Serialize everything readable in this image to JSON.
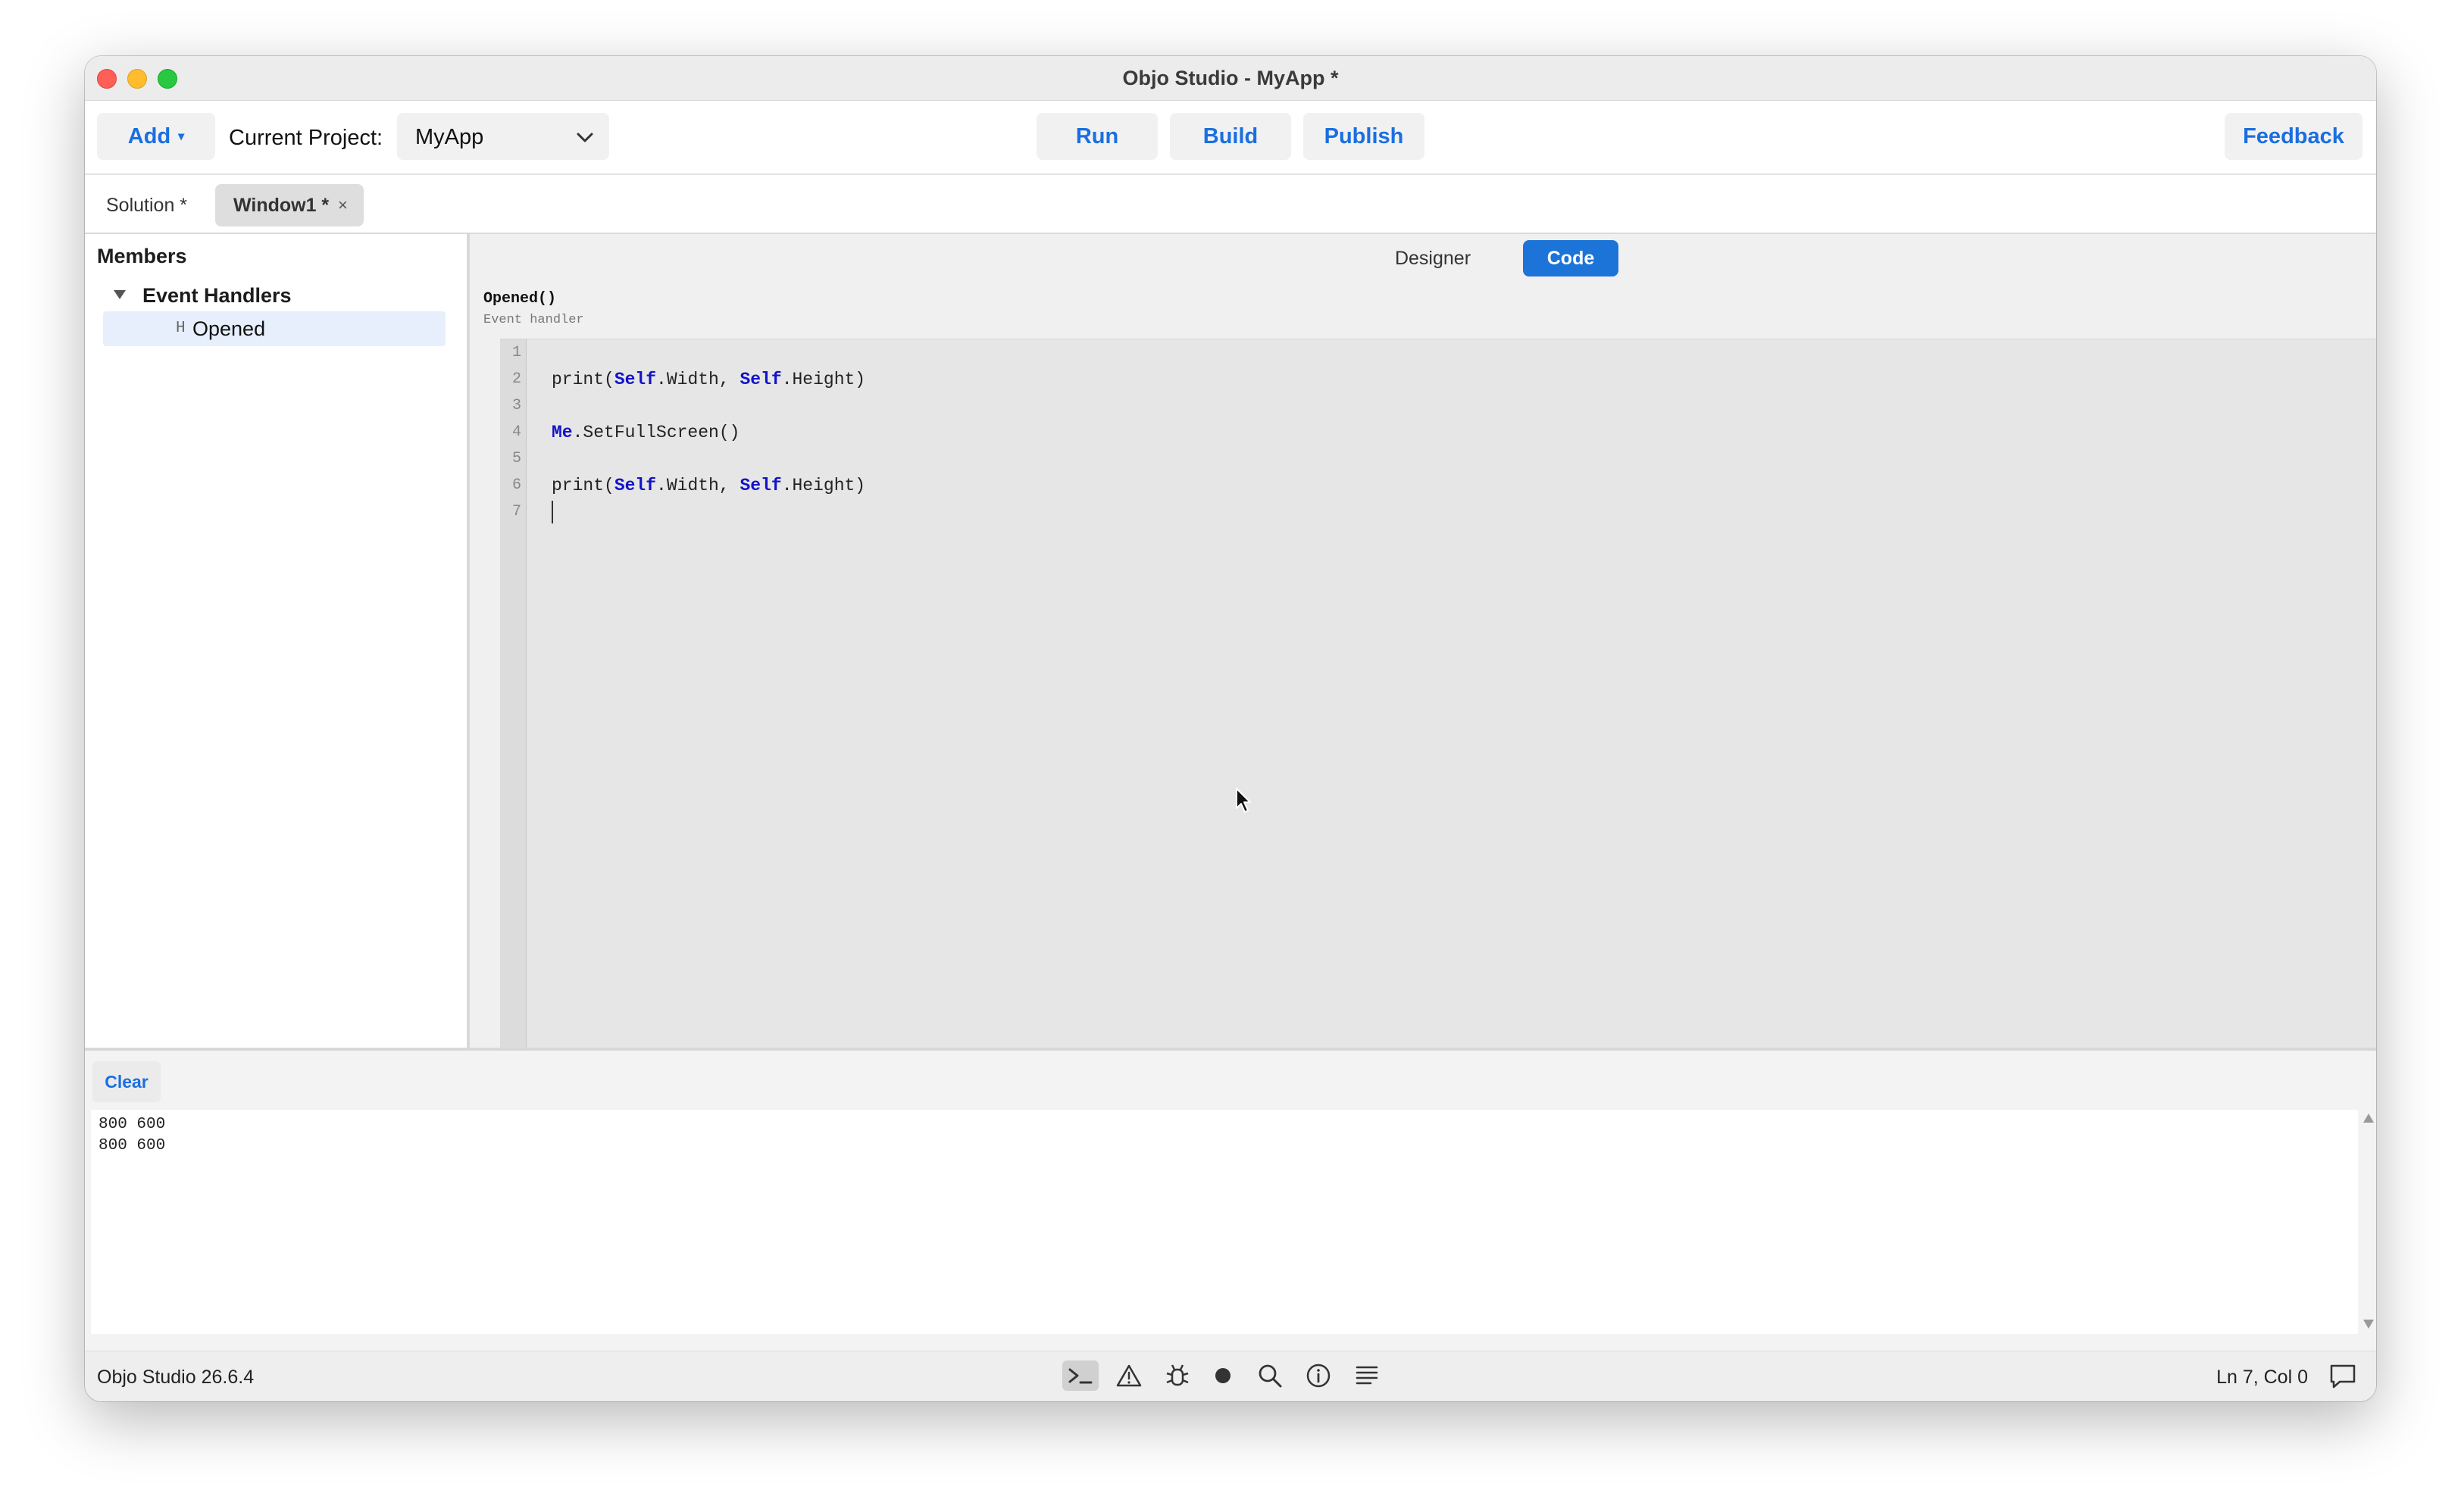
{
  "window": {
    "title": "Objo Studio - MyApp *"
  },
  "toolbar": {
    "add_label": "Add",
    "current_project_label": "Current Project:",
    "project_selected": "MyApp",
    "run_label": "Run",
    "build_label": "Build",
    "publish_label": "Publish",
    "feedback_label": "Feedback"
  },
  "tabs": [
    {
      "label": "Solution *"
    },
    {
      "label": "Window1 *",
      "close": "×"
    }
  ],
  "members": {
    "title": "Members",
    "group": "Event Handlers",
    "item_badge": "H",
    "item_label": "Opened"
  },
  "editor": {
    "view_designer": "Designer",
    "view_code": "Code",
    "signature": "Opened()",
    "signature_kind": "Event handler",
    "line_numbers": [
      "1",
      "2",
      "3",
      "4",
      "5",
      "6",
      "7"
    ],
    "lines": [
      "",
      "print(Self.Width, Self.Height)",
      "",
      "Me.SetFullScreen()",
      "",
      "print(Self.Width, Self.Height)",
      ""
    ]
  },
  "output": {
    "clear_label": "Clear",
    "lines": [
      "800 600",
      "800 600"
    ]
  },
  "status": {
    "version": "Objo Studio 26.6.4",
    "position": "Ln 7, Col 0",
    "icons": [
      "terminal-icon",
      "warning-icon",
      "bug-icon",
      "record-icon",
      "search-icon",
      "info-icon",
      "list-icon",
      "chat-icon"
    ]
  },
  "colors": {
    "accent": "#1a6fe0",
    "code_segment": "#1c74d8",
    "keyword": "#1212c8",
    "selected_row": "#e6effb"
  }
}
